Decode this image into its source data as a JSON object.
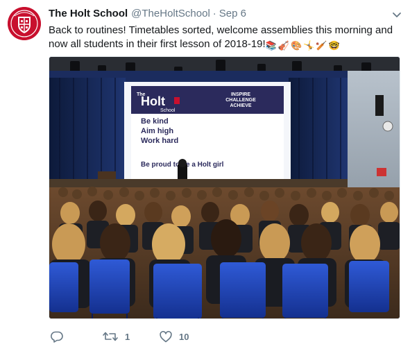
{
  "tweet": {
    "display_name": "The Holt School",
    "handle": "@TheHoltSchool",
    "separator": "·",
    "timestamp": "Sep 6",
    "text": "Back to routines!  Timetables sorted, welcome assemblies this morning and now all students in their first lesson of 2018-19!",
    "emojis": [
      "📚",
      "🎻",
      "🎨",
      "🤸",
      "🏏",
      "🤓"
    ]
  },
  "photo": {
    "alt": "Assembly hall with students seated facing a stage and projection screen",
    "slide": {
      "logo": "Holt",
      "logo_prefix": "The",
      "logo_suffix": "School",
      "motto": [
        "INSPIRE",
        "CHALLENGE",
        "ACHIEVE"
      ],
      "lines": [
        "Be kind",
        "Aim high",
        "Work hard"
      ],
      "footer": "Be proud to be a Holt girl"
    }
  },
  "actions": {
    "reply_count": "",
    "retweet_count": "1",
    "like_count": "10"
  },
  "icons": {
    "caret": "chevron-down-icon",
    "reply": "reply-icon",
    "retweet": "retweet-icon",
    "like": "heart-icon"
  },
  "colors": {
    "name": "#14171a",
    "secondary": "#657786",
    "school_red": "#c8102e",
    "slide_navy": "#2b2a5c"
  }
}
